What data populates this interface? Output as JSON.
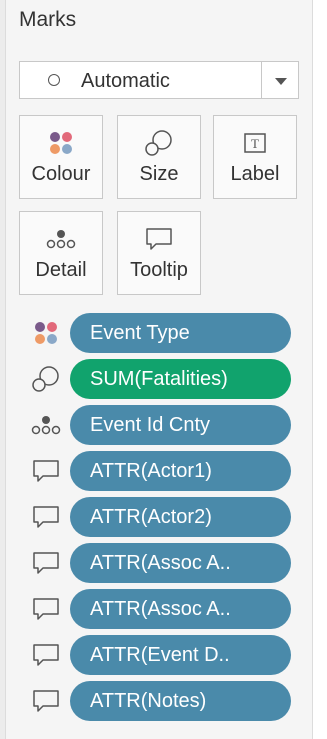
{
  "marks": {
    "title": "Marks",
    "mark_type": "Automatic",
    "tiles": {
      "colour": "Colour",
      "size": "Size",
      "label": "Label",
      "detail": "Detail",
      "tooltip": "Tooltip"
    },
    "fields": [
      {
        "label": "Event Type",
        "icon": "colour-icon",
        "color": "#4a8aaa"
      },
      {
        "label": "SUM(Fatalities)",
        "icon": "size-icon",
        "color": "#11a36d"
      },
      {
        "label": "Event Id Cnty",
        "icon": "detail-icon",
        "color": "#4a8aaa"
      },
      {
        "label": "ATTR(Actor1)",
        "icon": "tooltip-icon",
        "color": "#4a8aaa"
      },
      {
        "label": "ATTR(Actor2)",
        "icon": "tooltip-icon",
        "color": "#4a8aaa"
      },
      {
        "label": "ATTR(Assoc A..",
        "icon": "tooltip-icon",
        "color": "#4a8aaa"
      },
      {
        "label": "ATTR(Assoc A..",
        "icon": "tooltip-icon",
        "color": "#4a8aaa"
      },
      {
        "label": "ATTR(Event D..",
        "icon": "tooltip-icon",
        "color": "#4a8aaa"
      },
      {
        "label": "ATTR(Notes)",
        "icon": "tooltip-icon",
        "color": "#4a8aaa"
      }
    ]
  }
}
